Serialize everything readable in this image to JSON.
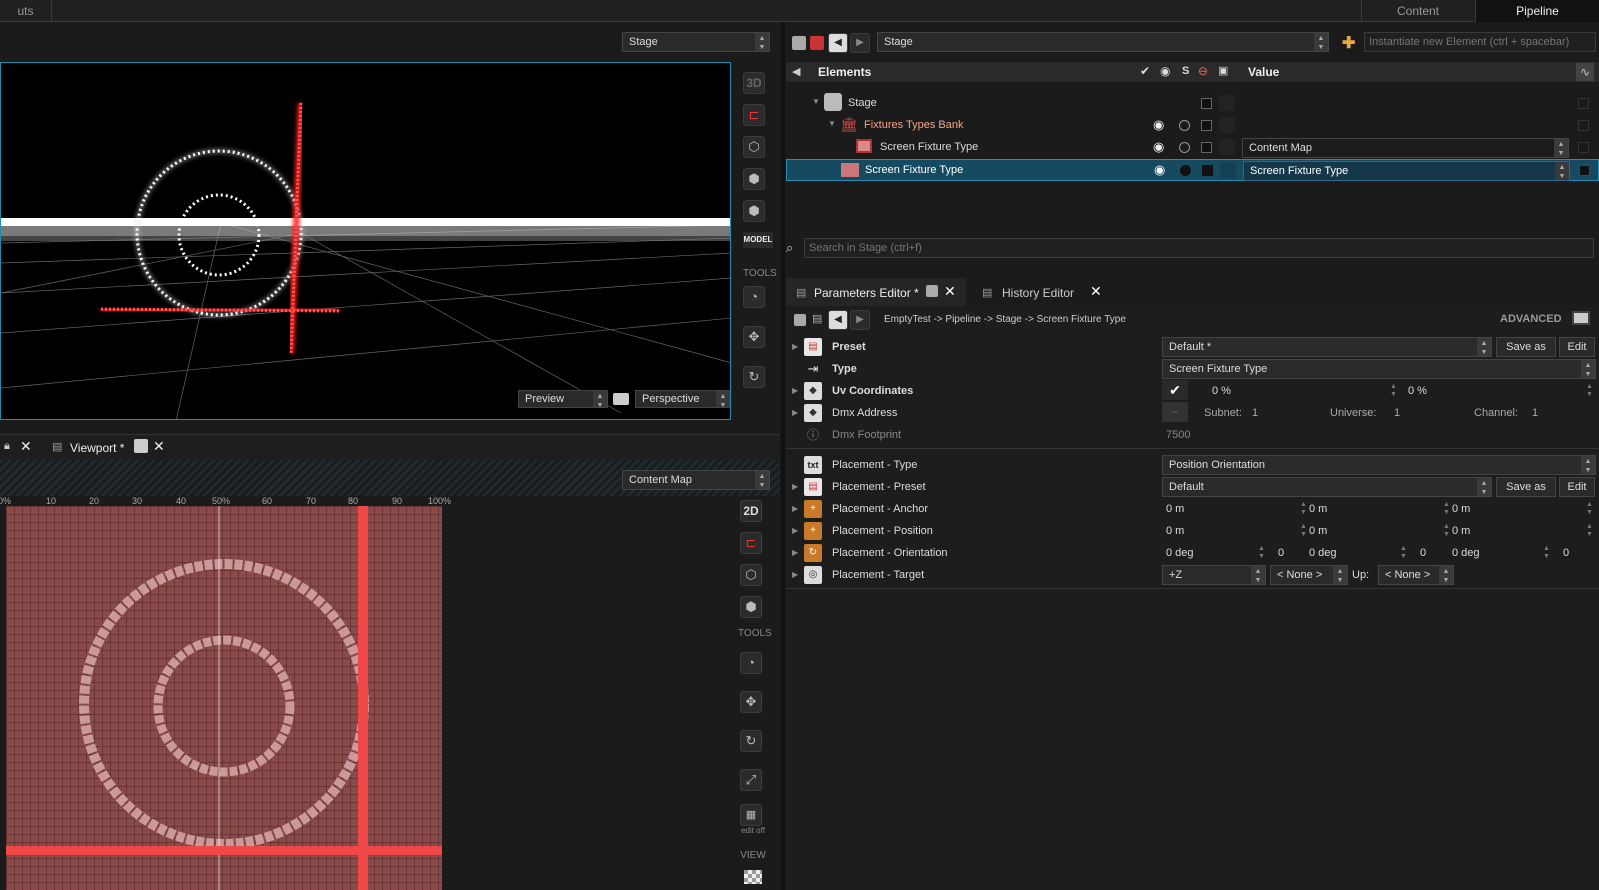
{
  "topbar": {
    "left_tab": "uts",
    "tabs": [
      "Content",
      "Pipeline"
    ]
  },
  "viewport3d": {
    "selector": "Stage",
    "preview": "Preview",
    "camera": "Perspective",
    "side_3d": "3D",
    "model_label": "MODEL",
    "tools_label": "TOOLS"
  },
  "viewport2d": {
    "tab_label": "Viewport *",
    "selector": "Content Map",
    "side_2d": "2D",
    "tools_label": "TOOLS",
    "edit_off": "edit off",
    "view_label": "VIEW",
    "ruler": [
      "0%",
      "10",
      "20",
      "30",
      "40",
      "50%",
      "60",
      "70",
      "80",
      "90",
      "100%"
    ]
  },
  "tree": {
    "stage_selector": "Stage",
    "instantiate_placeholder": "Instantiate new Element (ctrl + spacebar)",
    "header": {
      "elements": "Elements",
      "s": "S",
      "value": "Value"
    },
    "rows": [
      {
        "label": "Stage",
        "value": ""
      },
      {
        "label": "Fixtures Types Bank",
        "value": ""
      },
      {
        "label": "Screen Fixture Type",
        "value": "Content Map"
      },
      {
        "label": "Screen Fixture Type",
        "value": "Screen Fixture Type"
      }
    ],
    "search_placeholder": "Search in Stage (ctrl+f)"
  },
  "params": {
    "tabs": [
      "Parameters Editor *",
      "History Editor"
    ],
    "breadcrumb": "EmptyTest -> Pipeline -> Stage -> Screen Fixture Type",
    "advanced": "ADVANCED",
    "rows": [
      {
        "label": "Preset",
        "value": "Default *",
        "btn1": "Save as",
        "btn2": "Edit"
      },
      {
        "label": "Type",
        "value": "Screen Fixture Type"
      },
      {
        "label": "Uv Coordinates",
        "v1": "0 %",
        "v2": "0 %"
      },
      {
        "label": "Dmx Address",
        "subnet_label": "Subnet:",
        "subnet": "1",
        "universe_label": "Universe:",
        "universe": "1",
        "channel_label": "Channel:",
        "channel": "1"
      },
      {
        "label": "Dmx Footprint",
        "value": "7500"
      },
      {
        "label": "Placement - Type",
        "value": "Position Orientation"
      },
      {
        "label": "Placement - Preset",
        "value": "Default",
        "btn1": "Save as",
        "btn2": "Edit"
      },
      {
        "label": "Placement - Anchor",
        "v1": "0 m",
        "v2": "0 m",
        "v3": "0 m"
      },
      {
        "label": "Placement - Position",
        "v1": "0 m",
        "v2": "0 m",
        "v3": "0 m"
      },
      {
        "label": "Placement - Orientation",
        "v1": "0 deg",
        "n1": "0",
        "v2": "0 deg",
        "n2": "0",
        "v3": "0 deg",
        "n3": "0"
      },
      {
        "label": "Placement - Target",
        "target": "+Z",
        "none1": "< None >",
        "up": "Up:",
        "none2": "< None >"
      }
    ]
  }
}
